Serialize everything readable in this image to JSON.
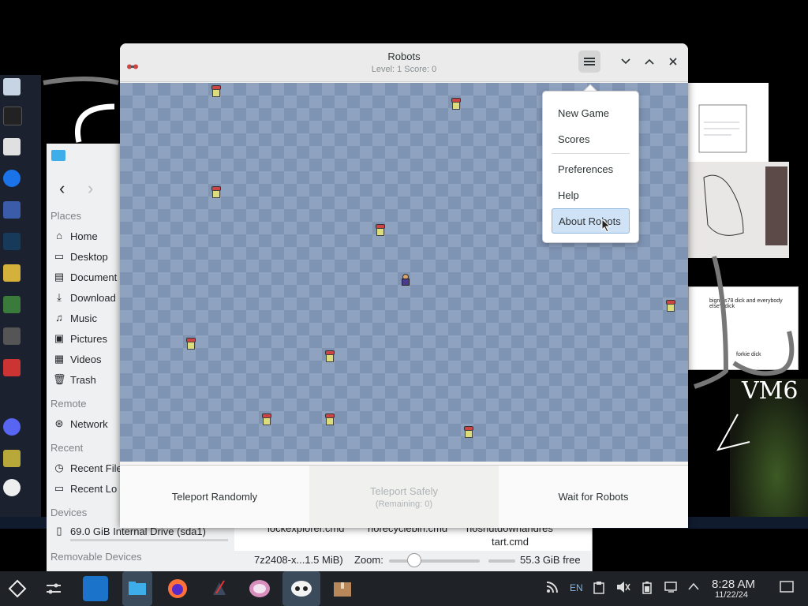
{
  "robots_window": {
    "title": "Robots",
    "subtitle": "Level: 1   Score: 0",
    "menu": {
      "items": [
        "New Game",
        "Scores",
        "Preferences",
        "Help",
        "About Robots"
      ],
      "active": "About Robots"
    },
    "buttons": {
      "teleport_randomly": "Teleport Randomly",
      "teleport_safely": "Teleport Safely",
      "teleport_safely_sub": "(Remaining: 0)",
      "wait": "Wait for Robots"
    }
  },
  "file_manager": {
    "places_label": "Places",
    "places": [
      "Home",
      "Desktop",
      "Document",
      "Download",
      "Music",
      "Pictures",
      "Videos",
      "Trash"
    ],
    "remote_label": "Remote",
    "remote": [
      "Network"
    ],
    "recent_label": "Recent",
    "recent": [
      "Recent File",
      "Recent Lo"
    ],
    "devices_label": "Devices",
    "devices": [
      "69.0 GiB Internal Drive (sda1)"
    ],
    "removable_label": "Removable Devices",
    "files_partial": [
      "lockexplorer.cmd",
      "norecyclebin.cmd",
      "noshutdownandres",
      "tart.cmd"
    ],
    "status_left": "7z2408-x...1.5 MiB)",
    "zoom_label": "Zoom:",
    "free_space": "55.3 GiB free"
  },
  "drawings": {
    "note1": "bignuts78 dick and everybody else's dick",
    "note2": "forkie dick",
    "vm_label": "VM6"
  },
  "taskbar": {
    "lang": "EN",
    "time": "8:28 AM",
    "date": "11/22/24"
  }
}
